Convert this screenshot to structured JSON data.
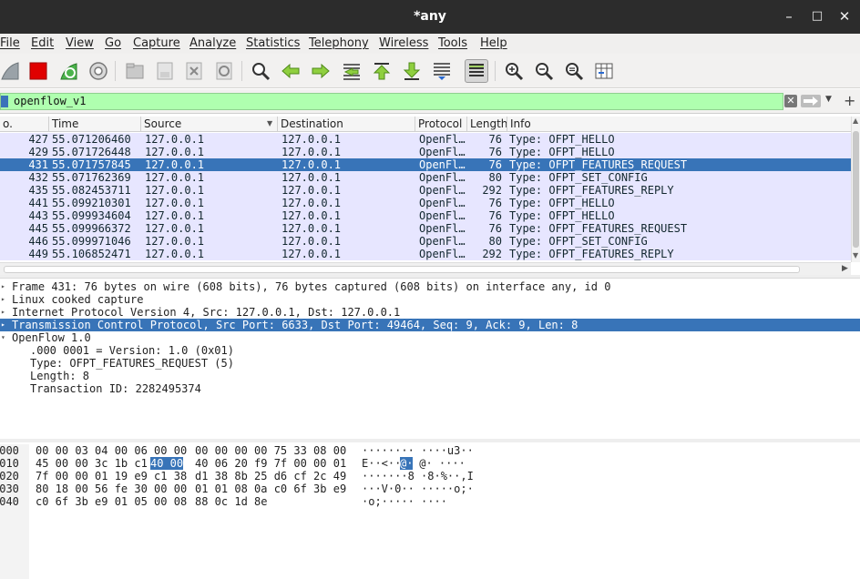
{
  "window": {
    "title": "*any",
    "minimize": "–",
    "maximize": "□",
    "close": "✕"
  },
  "menu": [
    "File",
    "Edit",
    "View",
    "Go",
    "Capture",
    "Analyze",
    "Statistics",
    "Telephony",
    "Wireless",
    "Tools",
    "Help"
  ],
  "toolbar": {
    "icons": [
      "shark-fin-start-icon",
      "stop-capture-icon",
      "restart-capture-icon",
      "capture-options-icon",
      "open-file-icon",
      "save-file-icon",
      "close-file-icon",
      "reload-file-icon",
      "find-packet-icon",
      "go-back-icon",
      "go-forward-icon",
      "go-to-packet-icon",
      "go-first-icon",
      "go-last-icon",
      "auto-scroll-icon",
      "colorize-icon",
      "zoom-in-icon",
      "zoom-out-icon",
      "zoom-normal-icon",
      "resize-columns-icon"
    ]
  },
  "filter": {
    "value": "openflow_v1",
    "clear": "✕"
  },
  "packet_list": {
    "columns": [
      "o.",
      "Time",
      "Source",
      "Destination",
      "Protocol",
      "Length",
      "Info"
    ],
    "rows": [
      {
        "no": "427",
        "time": "55.071206460",
        "src": "127.0.0.1",
        "dst": "127.0.0.1",
        "proto": "OpenFl…",
        "len": "76",
        "info": "Type: OFPT_HELLO"
      },
      {
        "no": "429",
        "time": "55.071726448",
        "src": "127.0.0.1",
        "dst": "127.0.0.1",
        "proto": "OpenFl…",
        "len": "76",
        "info": "Type: OFPT_HELLO"
      },
      {
        "no": "431",
        "time": "55.071757845",
        "src": "127.0.0.1",
        "dst": "127.0.0.1",
        "proto": "OpenFl…",
        "len": "76",
        "info": "Type: OFPT_FEATURES_REQUEST",
        "selected": true
      },
      {
        "no": "432",
        "time": "55.071762369",
        "src": "127.0.0.1",
        "dst": "127.0.0.1",
        "proto": "OpenFl…",
        "len": "80",
        "info": "Type: OFPT_SET_CONFIG"
      },
      {
        "no": "435",
        "time": "55.082453711",
        "src": "127.0.0.1",
        "dst": "127.0.0.1",
        "proto": "OpenFl…",
        "len": "292",
        "info": "Type: OFPT_FEATURES_REPLY"
      },
      {
        "no": "441",
        "time": "55.099210301",
        "src": "127.0.0.1",
        "dst": "127.0.0.1",
        "proto": "OpenFl…",
        "len": "76",
        "info": "Type: OFPT_HELLO"
      },
      {
        "no": "443",
        "time": "55.099934604",
        "src": "127.0.0.1",
        "dst": "127.0.0.1",
        "proto": "OpenFl…",
        "len": "76",
        "info": "Type: OFPT_HELLO"
      },
      {
        "no": "445",
        "time": "55.099966372",
        "src": "127.0.0.1",
        "dst": "127.0.0.1",
        "proto": "OpenFl…",
        "len": "76",
        "info": "Type: OFPT_FEATURES_REQUEST"
      },
      {
        "no": "446",
        "time": "55.099971046",
        "src": "127.0.0.1",
        "dst": "127.0.0.1",
        "proto": "OpenFl…",
        "len": "80",
        "info": "Type: OFPT_SET_CONFIG"
      },
      {
        "no": "449",
        "time": "55.106852471",
        "src": "127.0.0.1",
        "dst": "127.0.0.1",
        "proto": "OpenFl…",
        "len": "292",
        "info": "Type: OFPT_FEATURES_REPLY"
      }
    ]
  },
  "details": [
    {
      "text": "Frame 431: 76 bytes on wire (608 bits), 76 bytes captured (608 bits) on interface any, id 0",
      "arrow": "▸"
    },
    {
      "text": "Linux cooked capture",
      "arrow": "▸"
    },
    {
      "text": "Internet Protocol Version 4, Src: 127.0.0.1, Dst: 127.0.0.1",
      "arrow": "▸"
    },
    {
      "text": "Transmission Control Protocol, Src Port: 6633, Dst Port: 49464, Seq: 9, Ack: 9, Len: 8",
      "arrow": "▸",
      "selected": true
    },
    {
      "text": "OpenFlow 1.0",
      "arrow": "▾"
    },
    {
      "text": ".000 0001 = Version: 1.0 (0x01)",
      "indent": true
    },
    {
      "text": "Type: OFPT_FEATURES_REQUEST (5)",
      "indent": true
    },
    {
      "text": "Length: 8",
      "indent": true
    },
    {
      "text": "Transaction ID: 2282495374",
      "indent": true
    }
  ],
  "bytes": [
    {
      "offset": "0000",
      "hex_a": "00 00 03 04 00 06 00 00",
      "hex_b": "00 00 00 00 75 33 08 00",
      "ascii": "········ ····u3··"
    },
    {
      "offset": "0010",
      "hex_a_pre": "45 00 00 3c 1b c1 ",
      "hex_a_hl": "40 00",
      "hex_b": "40 06 20 f9 7f 00 00 01",
      "ascii_pre": "E··<··",
      "ascii_hl": "@·",
      "ascii_post": " @· ····"
    },
    {
      "offset": "0020",
      "hex_a": "7f 00 00 01 19 e9 c1 38",
      "hex_b": "d1 38 8b 25 d6 cf 2c 49",
      "ascii": "·······8 ·8·%··,I"
    },
    {
      "offset": "0030",
      "hex_a": "80 18 00 56 fe 30 00 00",
      "hex_b": "01 01 08 0a c0 6f 3b e9",
      "ascii": "···V·0·· ·····o;·"
    },
    {
      "offset": "0040",
      "hex_a": "c0 6f 3b e9 01 05 00 08",
      "hex_b": "88 0c 1d 8e",
      "ascii": "·o;····· ····"
    }
  ]
}
